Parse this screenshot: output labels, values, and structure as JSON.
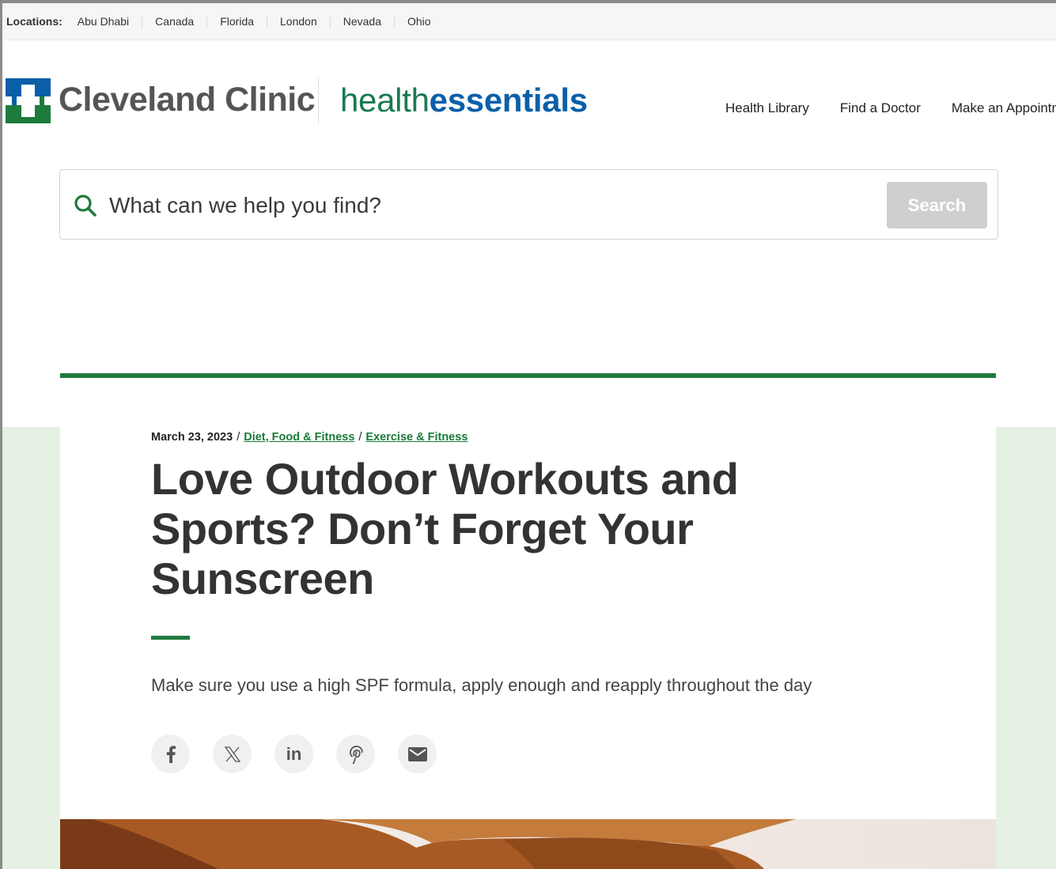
{
  "locations": {
    "label": "Locations:",
    "items": [
      "Abu Dhabi",
      "Canada",
      "Florida",
      "London",
      "Nevada",
      "Ohio"
    ]
  },
  "header": {
    "brand_name": "Cleveland Clinic",
    "sub_brand_light": "health",
    "sub_brand_bold": "essentials",
    "nav": [
      "Health Library",
      "Find a Doctor",
      "Make an Appointm"
    ]
  },
  "search": {
    "placeholder": "What can we help you find?",
    "button_label": "Search"
  },
  "article": {
    "date": "March 23, 2023",
    "separator": "/",
    "categories": [
      "Diet, Food & Fitness",
      "Exercise & Fitness"
    ],
    "title": "Love Outdoor Workouts and Sports? Don’t Forget Your Sunscreen",
    "subtitle": "Make sure you use a high SPF formula, apply enough and reapply throughout the day",
    "share": {
      "linkedin_text": "in"
    }
  },
  "icons": {
    "logo": "cleveland-clinic-logo",
    "search": "search-icon",
    "share": [
      "facebook-icon",
      "x-icon",
      "linkedin-icon",
      "pinterest-icon",
      "email-icon"
    ]
  },
  "colors": {
    "brand_green": "#1f7a3e",
    "brand_blue": "#0a5fa8",
    "accent_bg": "#e5f1e3",
    "search_button": "#cfcfcf"
  }
}
